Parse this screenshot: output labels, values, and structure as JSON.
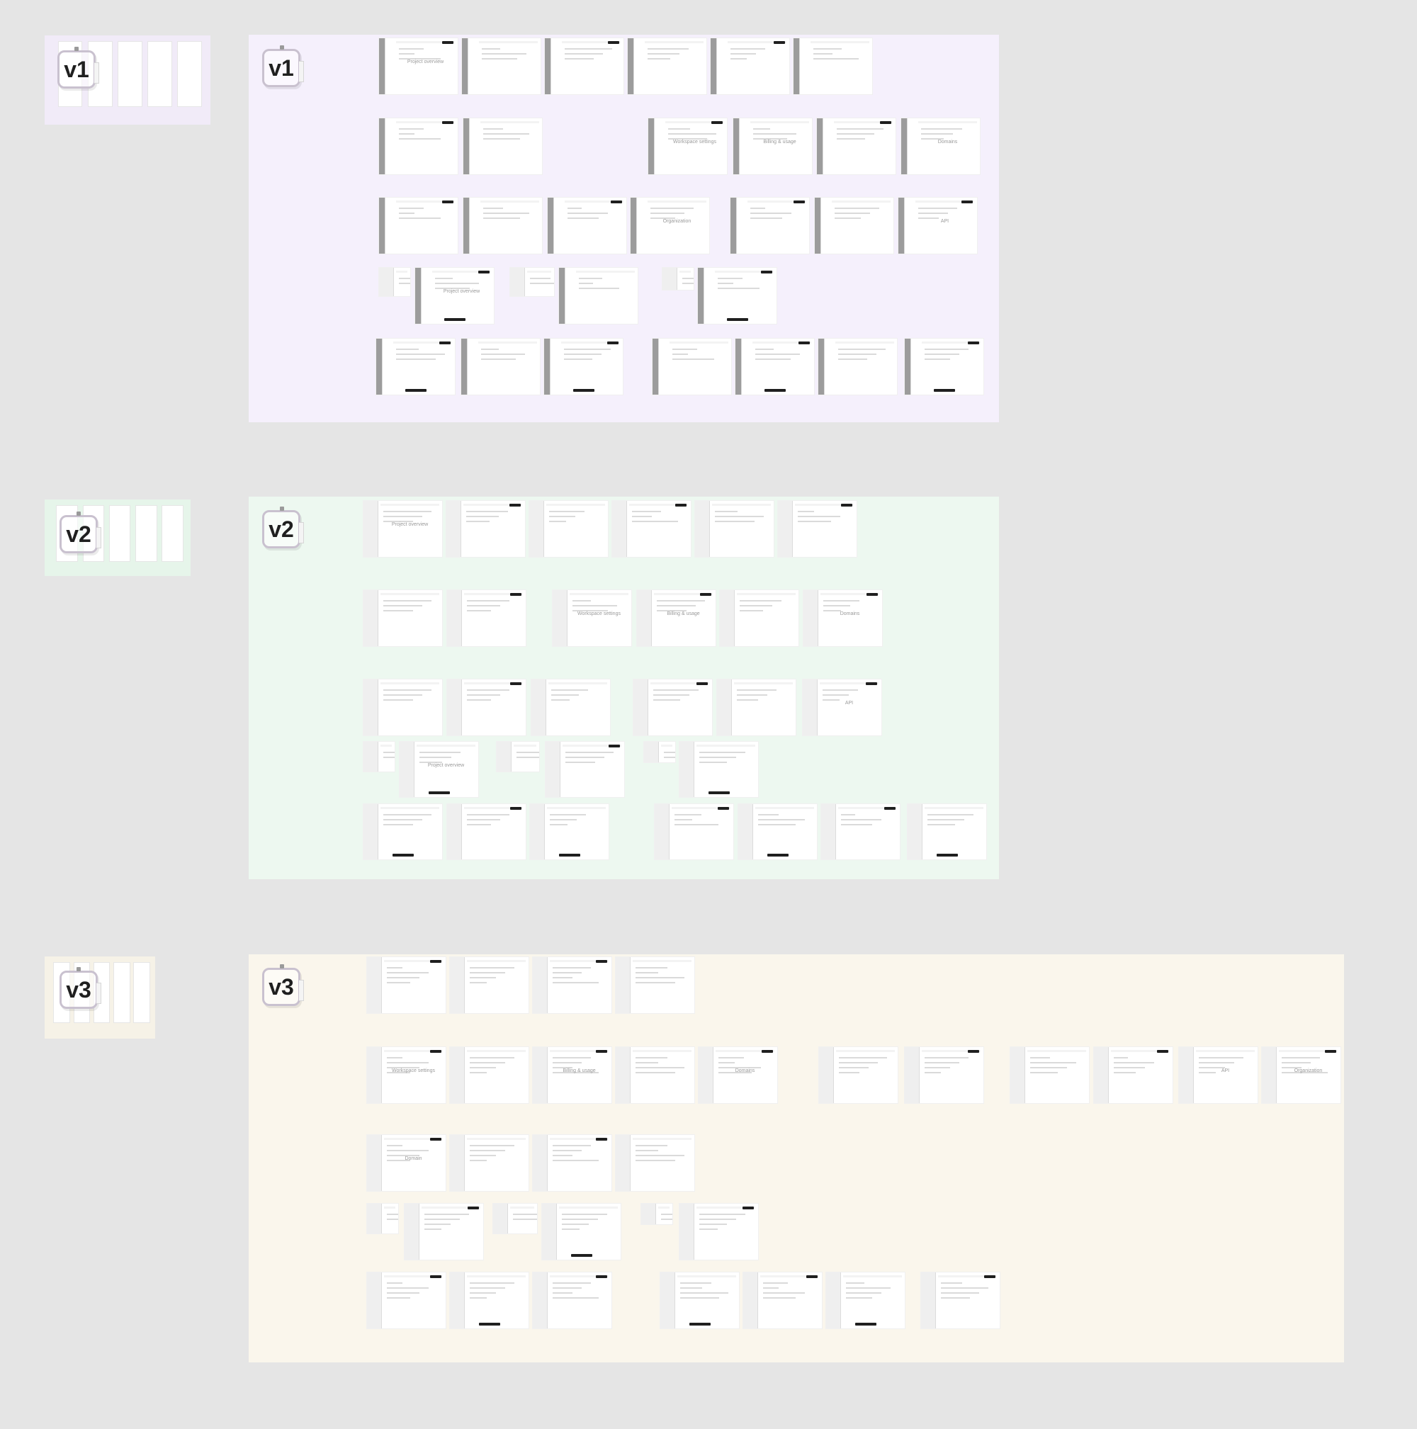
{
  "groups": [
    {
      "label": "v1",
      "thumb_color": "#f1ebf8",
      "frame_color": "#f5f0fc",
      "screen_captions": [
        "Project overview",
        "Workspace settings",
        "Billing & usage",
        "Domains",
        "Organization",
        "API",
        "Project overview"
      ]
    },
    {
      "label": "v2",
      "thumb_color": "#e6f5ea",
      "frame_color": "#edf8f0",
      "screen_captions": [
        "Project overview",
        "Workspace settings",
        "Billing & usage",
        "Domains",
        "API",
        "Project overview"
      ]
    },
    {
      "label": "v3",
      "thumb_color": "#f6f2e7",
      "frame_color": "#faf6ec",
      "screen_captions": [
        "Workspace settings",
        "Billing & usage",
        "Domains",
        "API",
        "Organization",
        "Domain"
      ]
    }
  ]
}
